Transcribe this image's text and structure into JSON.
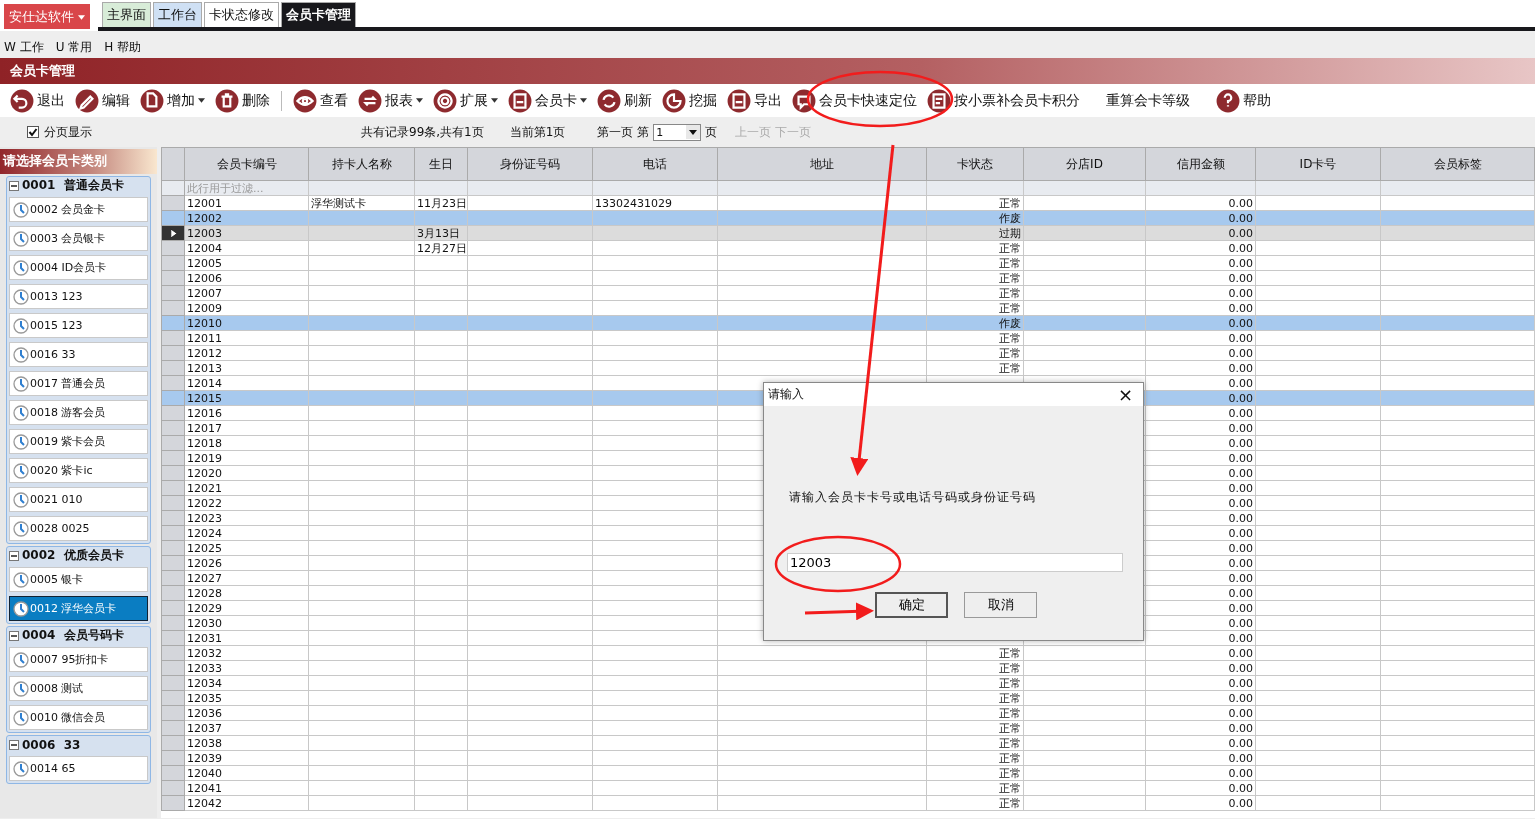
{
  "app_menu": {
    "label": "安仕达软件"
  },
  "tabs": [
    {
      "label": "主界面",
      "selected": false,
      "color": "#d8ecd8"
    },
    {
      "label": "工作台",
      "selected": false,
      "color": "#cfe0f4"
    },
    {
      "label": "卡状态修改",
      "selected": false,
      "color": "#ffffff"
    },
    {
      "label": "会员卡管理",
      "selected": true,
      "color": "#18181c"
    }
  ],
  "menu": [
    {
      "key": "W",
      "label": "工作"
    },
    {
      "key": "U",
      "label": "常用"
    },
    {
      "key": "H",
      "label": "帮助"
    }
  ],
  "panel_title": "会员卡管理",
  "toolbar": [
    {
      "kind": "back",
      "label": "退出",
      "dropdown": false
    },
    {
      "kind": "edit",
      "label": "编辑",
      "dropdown": false
    },
    {
      "kind": "add",
      "label": "增加",
      "dropdown": true
    },
    {
      "kind": "delete",
      "label": "删除",
      "dropdown": false
    },
    {
      "kind": "separator"
    },
    {
      "kind": "view",
      "label": "查看",
      "dropdown": false
    },
    {
      "kind": "report",
      "label": "报表",
      "dropdown": true
    },
    {
      "kind": "extend",
      "label": "扩展",
      "dropdown": true
    },
    {
      "kind": "card",
      "label": "会员卡",
      "dropdown": true
    },
    {
      "kind": "refresh",
      "label": "刷新",
      "dropdown": false
    },
    {
      "kind": "mine",
      "label": "挖掘",
      "dropdown": false
    },
    {
      "kind": "export",
      "label": "导出",
      "dropdown": false
    },
    {
      "kind": "locate",
      "label": "会员卡快速定位",
      "dropdown": false
    },
    {
      "kind": "points",
      "label": "按小票补会员卡积分",
      "dropdown": false
    },
    {
      "kind": "text",
      "label": "重算会卡等级",
      "dropdown": false
    },
    {
      "kind": "help",
      "label": "帮助",
      "dropdown": false
    }
  ],
  "pager": {
    "paged_label": "分页显示",
    "paged": true,
    "summary": "共有记录99条,共有1页",
    "current": "当前第1页",
    "first": "第一页",
    "page_prefix": "第",
    "page_value": "1",
    "page_suffix": "页",
    "prev": "上一页",
    "next": "下一页",
    "prev_disabled": true,
    "next_disabled": true
  },
  "sidebar": {
    "title": "请选择会员卡类别",
    "groups": [
      {
        "label": "0001  普通会员卡",
        "expanded": true,
        "items": [
          {
            "label": "0002 会员金卡",
            "selected": false
          },
          {
            "label": "0003 会员银卡",
            "selected": false
          },
          {
            "label": "0004 ID会员卡",
            "selected": false
          },
          {
            "label": "0013 123",
            "selected": false
          },
          {
            "label": "0015 123",
            "selected": false
          },
          {
            "label": "0016 33",
            "selected": false
          },
          {
            "label": "0017 普通会员",
            "selected": false
          },
          {
            "label": "0018 游客会员",
            "selected": false
          },
          {
            "label": "0019 紫卡会员",
            "selected": false
          },
          {
            "label": "0020 紫卡ic",
            "selected": false
          },
          {
            "label": "0021 010",
            "selected": false
          },
          {
            "label": "0028 0025",
            "selected": false
          }
        ]
      },
      {
        "label": "0002  优质会员卡",
        "expanded": true,
        "items": [
          {
            "label": "0005 银卡",
            "selected": false
          },
          {
            "label": "0012 浮华会员卡",
            "selected": true
          }
        ]
      },
      {
        "label": "0004  会员号码卡",
        "expanded": true,
        "items": [
          {
            "label": "0007 95折扣卡",
            "selected": false
          },
          {
            "label": "0008 测试",
            "selected": false
          },
          {
            "label": "0010 微信会员",
            "selected": false
          }
        ]
      },
      {
        "label": "0006  33",
        "expanded": true,
        "items": [
          {
            "label": "0014 65",
            "selected": false
          }
        ]
      }
    ]
  },
  "table": {
    "columns": [
      "会员卡编号",
      "持卡人名称",
      "生日",
      "身份证号码",
      "电话",
      "地址",
      "卡状态",
      "分店ID",
      "信用金额",
      "ID卡号",
      "会员标签"
    ],
    "filter_placeholder": "此行用于过滤...",
    "rows": [
      {
        "card_no": "12001",
        "holder": "浮华测试卡",
        "birthday": "11月23日",
        "phone": "13302431029",
        "status": "正常",
        "credit": "0.00",
        "selected": false,
        "current": false
      },
      {
        "card_no": "12002",
        "status": "作废",
        "credit": "0.00",
        "selected": true,
        "current": false
      },
      {
        "card_no": "12003",
        "birthday": "3月13日",
        "status": "过期",
        "credit": "0.00",
        "selected": false,
        "current": true
      },
      {
        "card_no": "12004",
        "birthday": "12月27日",
        "status": "正常",
        "credit": "0.00",
        "selected": false,
        "current": false
      },
      {
        "card_no": "12005",
        "status": "正常",
        "credit": "0.00",
        "selected": false,
        "current": false
      },
      {
        "card_no": "12006",
        "status": "正常",
        "credit": "0.00",
        "selected": false,
        "current": false
      },
      {
        "card_no": "12007",
        "status": "正常",
        "credit": "0.00",
        "selected": false,
        "current": false
      },
      {
        "card_no": "12009",
        "status": "正常",
        "credit": "0.00",
        "selected": false,
        "current": false
      },
      {
        "card_no": "12010",
        "status": "作废",
        "credit": "0.00",
        "selected": true,
        "current": false
      },
      {
        "card_no": "12011",
        "status": "正常",
        "credit": "0.00",
        "selected": false,
        "current": false
      },
      {
        "card_no": "12012",
        "status": "正常",
        "credit": "0.00",
        "selected": false,
        "current": false
      },
      {
        "card_no": "12013",
        "status": "正常",
        "credit": "0.00",
        "selected": false,
        "current": false
      },
      {
        "card_no": "12014",
        "credit": "0.00",
        "selected": false,
        "current": false
      },
      {
        "card_no": "12015",
        "credit": "0.00",
        "selected": true,
        "current": false
      },
      {
        "card_no": "12016",
        "credit": "0.00",
        "selected": false,
        "current": false
      },
      {
        "card_no": "12017",
        "credit": "0.00",
        "selected": false,
        "current": false
      },
      {
        "card_no": "12018",
        "credit": "0.00",
        "selected": false,
        "current": false
      },
      {
        "card_no": "12019",
        "credit": "0.00",
        "selected": false,
        "current": false
      },
      {
        "card_no": "12020",
        "credit": "0.00",
        "selected": false,
        "current": false
      },
      {
        "card_no": "12021",
        "credit": "0.00",
        "selected": false,
        "current": false
      },
      {
        "card_no": "12022",
        "credit": "0.00",
        "selected": false,
        "current": false
      },
      {
        "card_no": "12023",
        "credit": "0.00",
        "selected": false,
        "current": false
      },
      {
        "card_no": "12024",
        "credit": "0.00",
        "selected": false,
        "current": false
      },
      {
        "card_no": "12025",
        "credit": "0.00",
        "selected": false,
        "current": false
      },
      {
        "card_no": "12026",
        "credit": "0.00",
        "selected": false,
        "current": false
      },
      {
        "card_no": "12027",
        "credit": "0.00",
        "selected": false,
        "current": false
      },
      {
        "card_no": "12028",
        "credit": "0.00",
        "selected": false,
        "current": false
      },
      {
        "card_no": "12029",
        "credit": "0.00",
        "selected": false,
        "current": false
      },
      {
        "card_no": "12030",
        "credit": "0.00",
        "selected": false,
        "current": false
      },
      {
        "card_no": "12031",
        "credit": "0.00",
        "selected": false,
        "current": false
      },
      {
        "card_no": "12032",
        "status": "正常",
        "credit": "0.00",
        "selected": false,
        "current": false
      },
      {
        "card_no": "12033",
        "status": "正常",
        "credit": "0.00",
        "selected": false,
        "current": false
      },
      {
        "card_no": "12034",
        "status": "正常",
        "credit": "0.00",
        "selected": false,
        "current": false
      },
      {
        "card_no": "12035",
        "status": "正常",
        "credit": "0.00",
        "selected": false,
        "current": false
      },
      {
        "card_no": "12036",
        "status": "正常",
        "credit": "0.00",
        "selected": false,
        "current": false
      },
      {
        "card_no": "12037",
        "status": "正常",
        "credit": "0.00",
        "selected": false,
        "current": false
      },
      {
        "card_no": "12038",
        "status": "正常",
        "credit": "0.00",
        "selected": false,
        "current": false
      },
      {
        "card_no": "12039",
        "status": "正常",
        "credit": "0.00",
        "selected": false,
        "current": false
      },
      {
        "card_no": "12040",
        "status": "正常",
        "credit": "0.00",
        "selected": false,
        "current": false
      },
      {
        "card_no": "12041",
        "status": "正常",
        "credit": "0.00",
        "selected": false,
        "current": false
      },
      {
        "card_no": "12042",
        "status": "正常",
        "credit": "0.00",
        "selected": false,
        "current": false
      }
    ]
  },
  "dialog": {
    "title": "请输入",
    "close": "×",
    "message": "请输入会员卡卡号或电话号码或身份证号码",
    "value": "12003",
    "buttons": [
      {
        "label": "确定",
        "default": true
      },
      {
        "label": "取消",
        "default": false
      }
    ]
  }
}
